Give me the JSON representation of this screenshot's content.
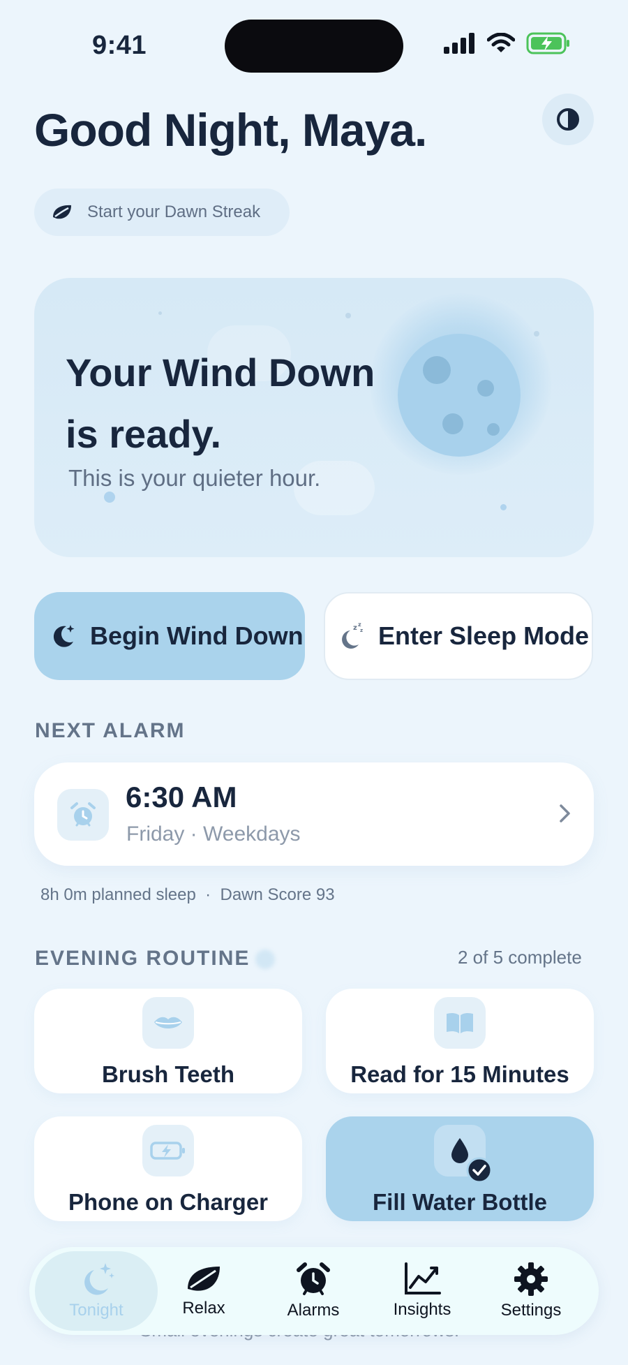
{
  "status_bar": {
    "time": "9:41"
  },
  "header": {
    "greeting": "Good Night, Maya.",
    "streak_label": "Start your Dawn Streak"
  },
  "hero": {
    "title": "Your Wind Down is ready.",
    "subtitle": "This is your quieter hour."
  },
  "actions": {
    "primary_label": "Begin Wind Down",
    "secondary_label": "Enter Sleep Mode"
  },
  "next_alarm": {
    "section_label": "NEXT ALARM",
    "time": "6:30 AM",
    "days": "Friday · Weekdays",
    "meta": "8h 0m planned sleep  ·  Dawn Score 93"
  },
  "routine": {
    "section_label": "EVENING ROUTINE",
    "progress": "2 of 5 complete",
    "items": [
      {
        "label": "Brush Teeth",
        "icon": "lips-icon",
        "done": false
      },
      {
        "label": "Read for 15 Minutes",
        "icon": "book-icon",
        "done": false
      },
      {
        "label": "Phone on Charger",
        "icon": "battery-charging-icon",
        "done": false
      },
      {
        "label": "Fill Water Bottle",
        "icon": "water-drop-icon",
        "done": true
      }
    ]
  },
  "footer_text": "Small evenings create great tomorrows.",
  "tabs": [
    {
      "label": "Tonight",
      "icon": "moon-stars-icon",
      "active": true
    },
    {
      "label": "Relax",
      "icon": "leaf-icon",
      "active": false
    },
    {
      "label": "Alarms",
      "icon": "alarm-clock-icon",
      "active": false
    },
    {
      "label": "Insights",
      "icon": "chart-line-icon",
      "active": false
    },
    {
      "label": "Settings",
      "icon": "gear-icon",
      "active": false
    }
  ],
  "colors": {
    "background": "#ECF5FC",
    "accent": "#AAD3EC",
    "text": "#18263D",
    "muted": "#647489",
    "battery": "#4CC35A"
  }
}
